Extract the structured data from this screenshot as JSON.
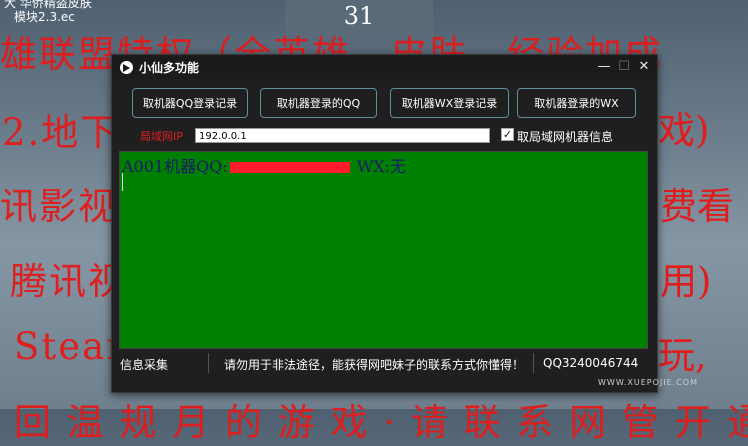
{
  "desktop": {
    "caption_line1": "大 华侨精盗皮肤",
    "caption_line2": "模块2.3.ec",
    "clock_value": "31",
    "bg_lines": [
      "雄联盟特权（全英雄、皮肤、经验加成",
      "2.地下",
      "讯影视",
      "腾讯视",
      "Steam",
      "回 温 规 月 的 游 戏 · 请 联 系 网 管 开 通"
    ],
    "right_frags": [
      "戏)",
      "费看",
      "用)",
      "玩,"
    ]
  },
  "window": {
    "title": "小仙多功能",
    "min_label": "—",
    "max_label": "☐",
    "close_label": "✕",
    "buttons": [
      "取机器QQ登录记录",
      "取机器登录的QQ",
      "取机器WX登录记录",
      "取机器登录的WX"
    ],
    "ip_label": "局域网IP",
    "ip_value": "192.0.0.1",
    "lan_checkbox_label": "取局域网机器信息",
    "lan_checked": true,
    "output_prefix": "A001机器QQ:",
    "output_suffix": " WX:无",
    "status": {
      "left": "信息采集",
      "middle": "请勿用于非法途径，能获得网吧妹子的联系方式你懂得！",
      "right": "QQ3240046744"
    },
    "watermark": "WWW.XUEPOJIE.COM"
  },
  "colors": {
    "output_bg": "#008000",
    "accent_red": "#e21c1c",
    "window_bg": "#1f1f1f"
  }
}
